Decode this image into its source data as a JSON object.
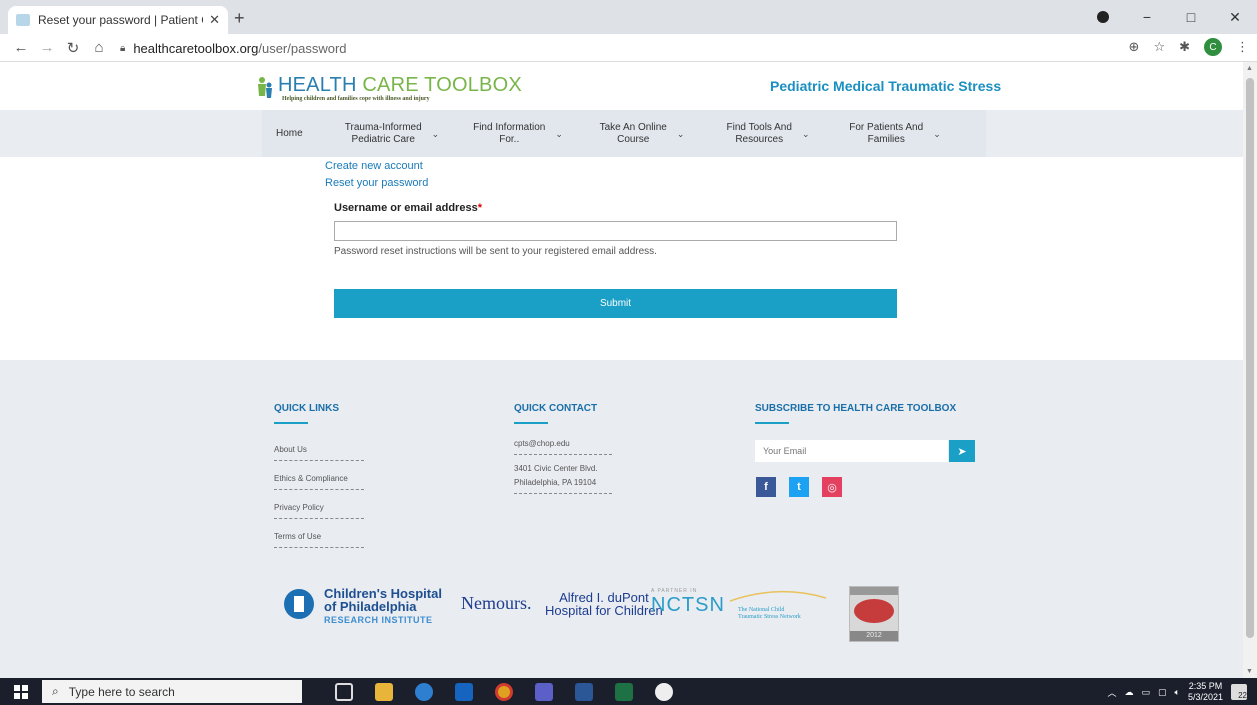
{
  "browser": {
    "tab_title": "Reset your password | Patient Ce",
    "tab_close": "✕",
    "new_tab": "+",
    "url_host": "healthcaretoolbox.org",
    "url_path": "/user/password",
    "profile_initial": "C",
    "win_min": "−",
    "win_max": "□",
    "win_close": "✕"
  },
  "site": {
    "logo_health": "HEALTH ",
    "logo_care": "CARE TOOLBOX",
    "logo_tagline": "Helping children and families cope with illness and injury",
    "subtitle": "Pediatric Medical Traumatic Stress"
  },
  "nav": {
    "items": [
      {
        "label": "Home",
        "has_menu": false
      },
      {
        "label": "Trauma-Informed\nPediatric Care",
        "has_menu": true
      },
      {
        "label": "Find Information\nFor..",
        "has_menu": true
      },
      {
        "label": "Take An Online\nCourse",
        "has_menu": true
      },
      {
        "label": "Find Tools And\nResources",
        "has_menu": true
      },
      {
        "label": "For Patients And\nFamilies",
        "has_menu": true
      }
    ]
  },
  "account_links": {
    "create": "Create new account",
    "reset": "Reset your password"
  },
  "form": {
    "label": "Username or email address",
    "required_mark": "*",
    "value": "",
    "help": "Password reset instructions will be sent to your registered email address.",
    "submit": "Submit"
  },
  "footer": {
    "quick_links_title": "QUICK LINKS",
    "quick_links": [
      "About Us",
      "Ethics & Compliance",
      "Privacy Policy",
      "Terms of Use"
    ],
    "quick_contact_title": "QUICK CONTACT",
    "email": "cpts@chop.edu",
    "address_line1": "3401 Civic Center Blvd.",
    "address_line2": "Philadelphia, PA 19104",
    "subscribe_title": "SUBSCRIBE TO HEALTH CARE TOOLBOX",
    "subscribe_placeholder": "Your Email",
    "social": [
      {
        "name": "facebook",
        "glyph": "f",
        "color": "#3b5998"
      },
      {
        "name": "twitter",
        "glyph": "t",
        "color": "#1da1f2"
      },
      {
        "name": "instagram",
        "glyph": "◎",
        "color": "#e4405f"
      }
    ]
  },
  "partners": {
    "chop_line1": "Children's Hospital",
    "chop_line2": "of Philadelphia",
    "chop_sub": "RESEARCH INSTITUTE",
    "nemours": "Nemours",
    "dupont_line1": "Alfred I. duPont",
    "dupont_line2": "Hospital for Children",
    "nctsn_top": "A PARTNER IN",
    "nctsn": "NCTSN",
    "ncts_line1": "The National Child",
    "ncts_line2": "Traumatic Stress Network",
    "award_year": "2012"
  },
  "taskbar": {
    "search_placeholder": "Type here to search",
    "time": "2:35 PM",
    "date": "5/3/2021",
    "notification_count": "22"
  },
  "colors": {
    "accent": "#1a9fc7",
    "link": "#1a7bb9",
    "nav_bg": "#e2e7ee",
    "footer_bg": "#e9ecf1"
  }
}
